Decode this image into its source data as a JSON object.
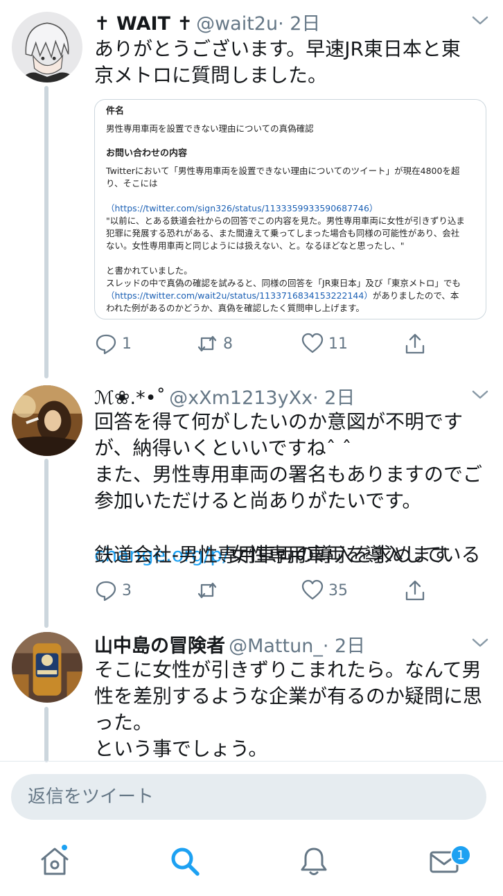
{
  "tweets": [
    {
      "name": "✝ WAIT ✝",
      "handle": "@wait2u",
      "time": "· 2日",
      "text": "ありがとうございます。早速JR東日本と東\n京メトロに質問しました。",
      "card": {
        "subject_label": "件名",
        "subject": "男性専用車両を設置できない理由についての真偽確認",
        "content_label": "お問い合わせの内容",
        "line1": "Twitterにおいて「男性専用車両を設置できない理由についてのツイート」が現在4800を超",
        "line2": "り、そこには",
        "link1": "（https://twitter.com/sign326/status/1133359933590687746）",
        "line3": "\"以前に、とある鉄道会社からの回答でこの内容を見た。男性専用車両に女性が引きずり込ま",
        "line4": "犯罪に発展する恐れがある、また間違えて乗ってしまった場合も同様の可能性があり、会社",
        "line5": "ない。女性専用車両と同じようには扱えない、と。なるほどなと思ったし、\"",
        "line6": "と書かれていました。",
        "line7": "スレッドの中で真偽の確認を試みると、同様の回答を「JR東日本」及び「東京メトロ」でも",
        "link2": "（https://twitter.com/wait2u/status/1133716834153222144）",
        "line8_rest": "がありましたので、本",
        "line9": "われた例があるのかどうか、真偽を確認したく質問申し上げます。"
      },
      "replies": "1",
      "retweets": "8",
      "likes": "11"
    },
    {
      "name": "ℳ❀.*•˚",
      "handle": "@xXm1213yXx",
      "time": "· 2日",
      "text": "回答を得て何がしたいのか意図が不明です\nが、納得いくといいですねˆ ˆ\nまた、男性専用車両の署名もありますのでご\n参加いただけると尚ありがたいです。",
      "link": "change.org/p/",
      "link_rest": "女性専用車両を導入している",
      "text_tail": "鉄道会社-男性専用車両の導入を求めます",
      "replies": "3",
      "retweets": "",
      "likes": "35"
    },
    {
      "name": "山中島の冒険者",
      "handle": "@Mattun_",
      "time": "· 2日",
      "text": "そこに女性が引きずりこまれたら。なんて男\n性を差別するような企業が有るのか疑問に思\nった。\nという事でしょう。"
    }
  ],
  "reply_placeholder": "返信をツイート",
  "tabs": {
    "home_icon": "home-icon",
    "search_icon": "search-icon",
    "notifications_icon": "bell-icon",
    "messages_icon": "mail-icon",
    "messages_badge": "1"
  },
  "colors": {
    "accent": "#1da1f2",
    "secondary_text": "#657786",
    "thread_line": "#ccd6dd"
  }
}
